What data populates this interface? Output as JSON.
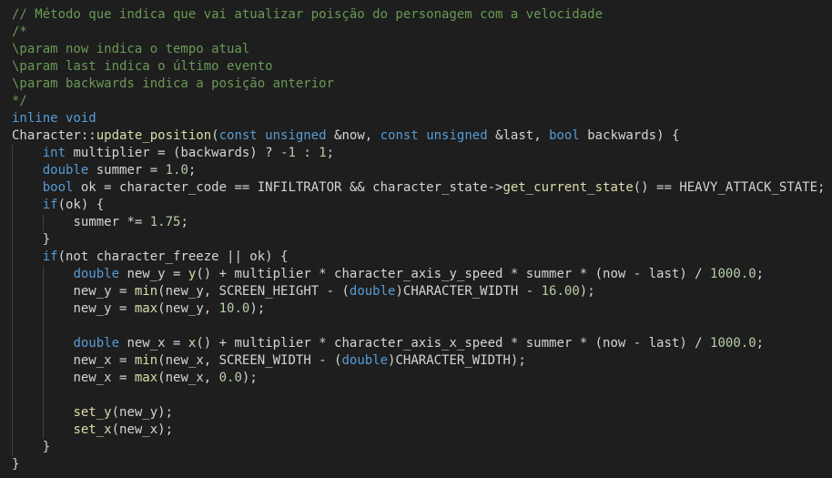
{
  "editor": {
    "colors": {
      "background": "#1e1e1e",
      "comment": "#6a9955",
      "keyword": "#569cd6",
      "function": "#dcdcaa",
      "number": "#b5cea8",
      "text": "#d4d4d4",
      "indent_guide": "#404040"
    },
    "lines": [
      {
        "indent": 0,
        "tokens": [
          {
            "t": "// Método que indica que vai atualizar poisção do personagem com a velocidade",
            "k": "comment"
          }
        ]
      },
      {
        "indent": 0,
        "tokens": [
          {
            "t": "/*",
            "k": "comment"
          }
        ]
      },
      {
        "indent": 0,
        "tokens": [
          {
            "t": "\\param now indica o tempo atual",
            "k": "comment"
          }
        ]
      },
      {
        "indent": 0,
        "tokens": [
          {
            "t": "\\param last indica o último evento",
            "k": "comment"
          }
        ]
      },
      {
        "indent": 0,
        "tokens": [
          {
            "t": "\\param backwards indica a posição anterior",
            "k": "comment"
          }
        ]
      },
      {
        "indent": 0,
        "tokens": [
          {
            "t": "*/",
            "k": "comment"
          }
        ]
      },
      {
        "indent": 0,
        "tokens": [
          {
            "t": "inline void",
            "k": "keyword"
          }
        ]
      },
      {
        "indent": 0,
        "tokens": [
          {
            "t": "Character::",
            "k": "default"
          },
          {
            "t": "update_position",
            "k": "func"
          },
          {
            "t": "(",
            "k": "default"
          },
          {
            "t": "const unsigned",
            "k": "keyword"
          },
          {
            "t": " &now, ",
            "k": "default"
          },
          {
            "t": "const unsigned",
            "k": "keyword"
          },
          {
            "t": " &last, ",
            "k": "default"
          },
          {
            "t": "bool",
            "k": "keyword"
          },
          {
            "t": " backwards) {",
            "k": "default"
          }
        ]
      },
      {
        "indent": 1,
        "tokens": [
          {
            "t": "int",
            "k": "keyword"
          },
          {
            "t": " multiplier = (backwards) ? ",
            "k": "default"
          },
          {
            "t": "-1",
            "k": "number"
          },
          {
            "t": " : ",
            "k": "default"
          },
          {
            "t": "1",
            "k": "number"
          },
          {
            "t": ";",
            "k": "default"
          }
        ]
      },
      {
        "indent": 1,
        "tokens": [
          {
            "t": "double",
            "k": "keyword"
          },
          {
            "t": " summer = ",
            "k": "default"
          },
          {
            "t": "1.0",
            "k": "number"
          },
          {
            "t": ";",
            "k": "default"
          }
        ]
      },
      {
        "indent": 1,
        "tokens": [
          {
            "t": "bool",
            "k": "keyword"
          },
          {
            "t": " ok = character_code == INFILTRATOR && character_state->",
            "k": "default"
          },
          {
            "t": "get_current_state",
            "k": "func"
          },
          {
            "t": "() == HEAVY_ATTACK_STATE;",
            "k": "default"
          }
        ]
      },
      {
        "indent": 1,
        "tokens": [
          {
            "t": "if",
            "k": "keyword"
          },
          {
            "t": "(ok) {",
            "k": "default"
          }
        ]
      },
      {
        "indent": 2,
        "tokens": [
          {
            "t": "summer *= ",
            "k": "default"
          },
          {
            "t": "1.75",
            "k": "number"
          },
          {
            "t": ";",
            "k": "default"
          }
        ]
      },
      {
        "indent": 1,
        "tokens": [
          {
            "t": "}",
            "k": "default"
          }
        ]
      },
      {
        "indent": 1,
        "tokens": [
          {
            "t": "if",
            "k": "keyword"
          },
          {
            "t": "(not character_freeze || ok) {",
            "k": "default"
          }
        ]
      },
      {
        "indent": 2,
        "tokens": [
          {
            "t": "double",
            "k": "keyword"
          },
          {
            "t": " new_y = ",
            "k": "default"
          },
          {
            "t": "y",
            "k": "func"
          },
          {
            "t": "() + multiplier * character_axis_y_speed * summer * (now - last) / ",
            "k": "default"
          },
          {
            "t": "1000.0",
            "k": "number"
          },
          {
            "t": ";",
            "k": "default"
          }
        ]
      },
      {
        "indent": 2,
        "tokens": [
          {
            "t": "new_y = ",
            "k": "default"
          },
          {
            "t": "min",
            "k": "func"
          },
          {
            "t": "(new_y, SCREEN_HEIGHT - (",
            "k": "default"
          },
          {
            "t": "double",
            "k": "keyword"
          },
          {
            "t": ")CHARACTER_WIDTH - ",
            "k": "default"
          },
          {
            "t": "16.00",
            "k": "number"
          },
          {
            "t": ");",
            "k": "default"
          }
        ]
      },
      {
        "indent": 2,
        "tokens": [
          {
            "t": "new_y = ",
            "k": "default"
          },
          {
            "t": "max",
            "k": "func"
          },
          {
            "t": "(new_y, ",
            "k": "default"
          },
          {
            "t": "10.0",
            "k": "number"
          },
          {
            "t": ");",
            "k": "default"
          }
        ]
      },
      {
        "indent": 2,
        "blank": true,
        "tokens": []
      },
      {
        "indent": 2,
        "tokens": [
          {
            "t": "double",
            "k": "keyword"
          },
          {
            "t": " new_x = ",
            "k": "default"
          },
          {
            "t": "x",
            "k": "func"
          },
          {
            "t": "() + multiplier * character_axis_x_speed * summer * (now - last) / ",
            "k": "default"
          },
          {
            "t": "1000.0",
            "k": "number"
          },
          {
            "t": ";",
            "k": "default"
          }
        ]
      },
      {
        "indent": 2,
        "tokens": [
          {
            "t": "new_x = ",
            "k": "default"
          },
          {
            "t": "min",
            "k": "func"
          },
          {
            "t": "(new_x, SCREEN_WIDTH - (",
            "k": "default"
          },
          {
            "t": "double",
            "k": "keyword"
          },
          {
            "t": ")CHARACTER_WIDTH);",
            "k": "default"
          }
        ]
      },
      {
        "indent": 2,
        "tokens": [
          {
            "t": "new_x = ",
            "k": "default"
          },
          {
            "t": "max",
            "k": "func"
          },
          {
            "t": "(new_x, ",
            "k": "default"
          },
          {
            "t": "0.0",
            "k": "number"
          },
          {
            "t": ");",
            "k": "default"
          }
        ]
      },
      {
        "indent": 2,
        "blank": true,
        "tokens": []
      },
      {
        "indent": 2,
        "tokens": [
          {
            "t": "set_y",
            "k": "func"
          },
          {
            "t": "(new_y);",
            "k": "default"
          }
        ]
      },
      {
        "indent": 2,
        "tokens": [
          {
            "t": "set_x",
            "k": "func"
          },
          {
            "t": "(new_x);",
            "k": "default"
          }
        ]
      },
      {
        "indent": 1,
        "tokens": [
          {
            "t": "}",
            "k": "default"
          }
        ]
      },
      {
        "indent": 0,
        "tokens": [
          {
            "t": "}",
            "k": "default"
          }
        ]
      }
    ]
  }
}
